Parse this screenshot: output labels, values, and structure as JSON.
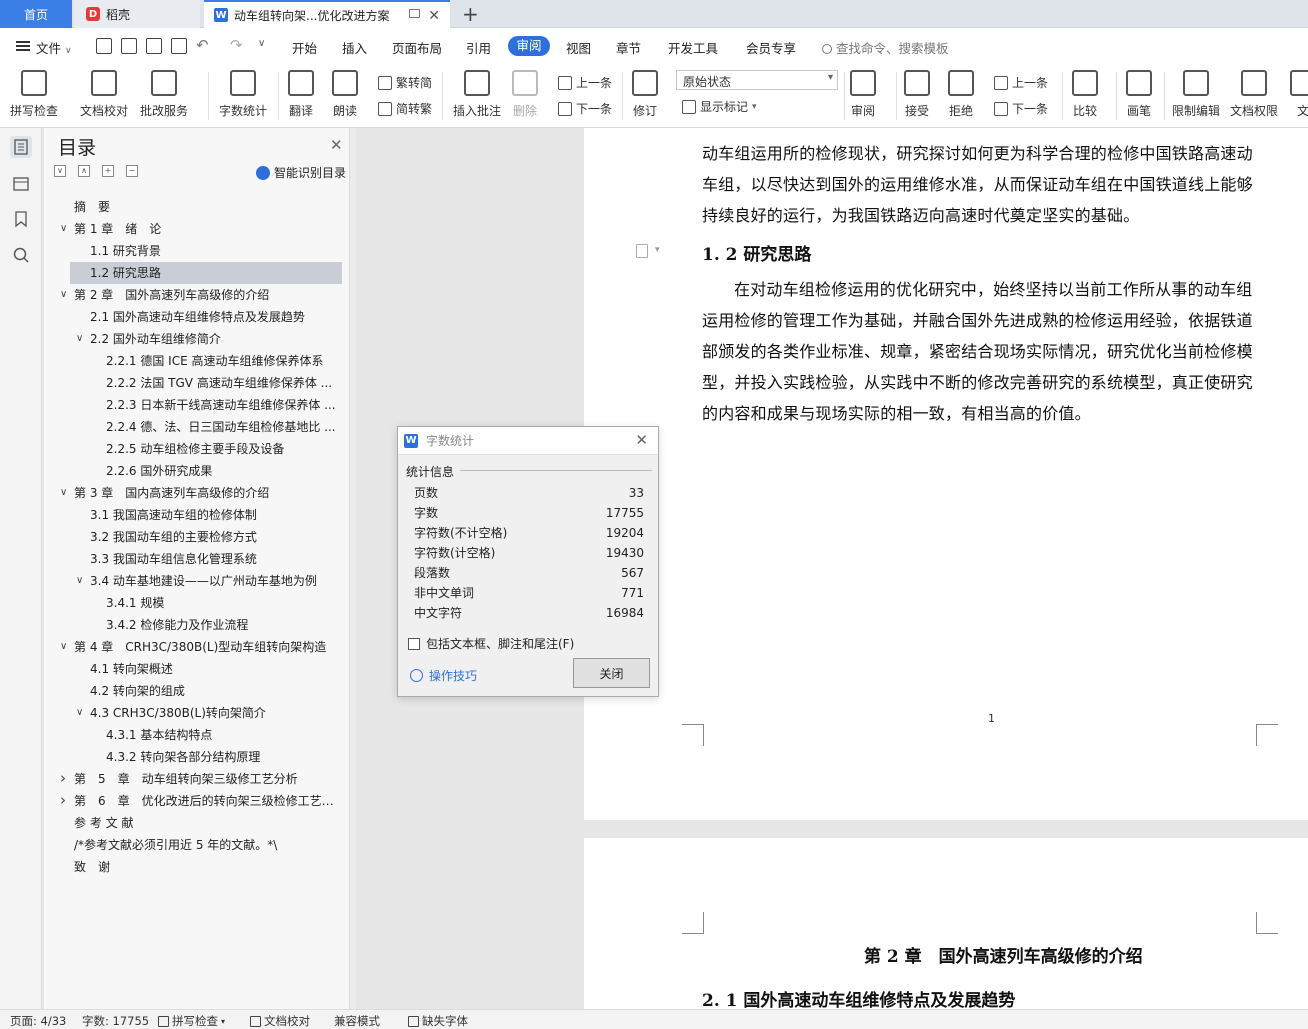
{
  "tabs": {
    "home": "首页",
    "daoke": "稻壳",
    "doc": "动车组转向架...优化改进方案"
  },
  "menu": {
    "file": "文件",
    "items": [
      "开始",
      "插入",
      "页面布局",
      "引用",
      "审阅",
      "视图",
      "章节",
      "开发工具",
      "会员专享"
    ],
    "active": "审阅",
    "search_placeholder": "查找命令、搜索模板"
  },
  "ribbon": {
    "spellcheck": "拼写检查",
    "doc_proof": "文档校对",
    "batch_service": "批改服务",
    "word_count": "字数统计",
    "translate": "翻译",
    "read_aloud": "朗读",
    "trad_to_simp": "繁转简",
    "simp_to_trad": "简转繁",
    "insert_comment": "插入批注",
    "delete": "删除",
    "prev": "上一条",
    "next": "下一条",
    "revise": "修订",
    "status_value": "原始状态",
    "show_marks": "显示标记",
    "review": "审阅",
    "accept": "接受",
    "reject": "拒绝",
    "prev2": "上一条",
    "next2": "下一条",
    "compare": "比较",
    "pen": "画笔",
    "restrict_edit": "限制编辑",
    "doc_rights": "文档权限",
    "doc_cut": "文"
  },
  "toc": {
    "title": "目录",
    "smart": "智能识别目录",
    "items": [
      {
        "text": "摘　要",
        "level": 0,
        "caret": ""
      },
      {
        "text": "第 1 章　绪　论",
        "level": 0,
        "caret": "v"
      },
      {
        "text": "1.1 研究背景",
        "level": 1,
        "caret": ""
      },
      {
        "text": "1.2 研究思路",
        "level": 1,
        "caret": "",
        "selected": true
      },
      {
        "text": "第 2 章　国外高速列车高级修的介绍",
        "level": 0,
        "caret": "v"
      },
      {
        "text": "2.1 国外高速动车组维修特点及发展趋势",
        "level": 1,
        "caret": ""
      },
      {
        "text": "2.2 国外动车组维修简介",
        "level": 1,
        "caret": "v"
      },
      {
        "text": "2.2.1 德国 ICE 高速动车组维修保养体系",
        "level": 2,
        "caret": ""
      },
      {
        "text": "2.2.2  法国 TGV 高速动车组维修保养体 ...",
        "level": 2,
        "caret": ""
      },
      {
        "text": "2.2.3 日本新干线高速动车组维修保养体 ...",
        "level": 2,
        "caret": ""
      },
      {
        "text": "2.2.4 德、法、日三国动车组检修基地比 ...",
        "level": 2,
        "caret": ""
      },
      {
        "text": "2.2.5 动车组检修主要手段及设备",
        "level": 2,
        "caret": ""
      },
      {
        "text": "2.2.6 国外研究成果",
        "level": 2,
        "caret": ""
      },
      {
        "text": "第 3 章　国内高速列车高级修的介绍",
        "level": 0,
        "caret": "v"
      },
      {
        "text": "3.1 我国高速动车组的检修体制",
        "level": 1,
        "caret": ""
      },
      {
        "text": "3.2 我国动车组的主要检修方式",
        "level": 1,
        "caret": ""
      },
      {
        "text": "3.3 我国动车组信息化管理系统",
        "level": 1,
        "caret": ""
      },
      {
        "text": "3.4 动车基地建设——以广州动车基地为例",
        "level": 1,
        "caret": "v"
      },
      {
        "text": "3.4.1 规模",
        "level": 2,
        "caret": ""
      },
      {
        "text": "3.4.2 检修能力及作业流程",
        "level": 2,
        "caret": ""
      },
      {
        "text": "第 4 章　CRH3C/380B(L)型动车组转向架构造",
        "level": 0,
        "caret": "v"
      },
      {
        "text": "4.1 转向架概述",
        "level": 1,
        "caret": ""
      },
      {
        "text": "4.2 转向架的组成",
        "level": 1,
        "caret": ""
      },
      {
        "text": "4.3 CRH3C/380B(L)转向架简介",
        "level": 1,
        "caret": "v"
      },
      {
        "text": "4.3.1 基本结构特点",
        "level": 2,
        "caret": ""
      },
      {
        "text": "4.3.2 转向架各部分结构原理",
        "level": 2,
        "caret": ""
      },
      {
        "text": "第　5　章　动车组转向架三级修工艺分析",
        "level": 0,
        "caret": ">"
      },
      {
        "text": "第　6　章　优化改进后的转向架三级检修工艺方 ...",
        "level": 0,
        "caret": ">"
      },
      {
        "text": "参 考 文 献",
        "level": 0,
        "caret": ""
      },
      {
        "text": "/*参考文献必须引用近 5 年的文献。*\\",
        "level": 0,
        "caret": ""
      },
      {
        "text": "致　谢",
        "level": 0,
        "caret": ""
      }
    ]
  },
  "document": {
    "para1": "动车组运用所的检修现状，研究探讨如何更为科学合理的检修中国铁路高速动车组，以尽快达到国外的运用维修水准，从而保证动车组在中国铁道线上能够持续良好的运行，为我国铁路迈向高速时代奠定坚实的基础。",
    "heading": "1. 2 研究思路",
    "para2": "在对动车组检修运用的优化研究中，始终坚持以当前工作所从事的动车组运用检修的管理工作为基础，并融合国外先进成熟的检修运用经验，依据铁道部颁发的各类作业标准、规章，紧密结合现场实际情况，研究优化当前检修模型，并投入实践检验，从实践中不断的修改完善研究的系统模型，真正使研究的内容和成果与现场实际的相一致，有相当高的价值。",
    "page_number": "1",
    "chapter2": "第 2 章　国外高速列车高级修的介绍",
    "section21": "2. 1 国外高速动车组维修特点及发展趋势"
  },
  "dialog": {
    "title": "字数统计",
    "group": "统计信息",
    "rows": [
      {
        "label": "页数",
        "value": "33"
      },
      {
        "label": "字数",
        "value": "17755"
      },
      {
        "label": "字符数(不计空格)",
        "value": "19204"
      },
      {
        "label": "字符数(计空格)",
        "value": "19430"
      },
      {
        "label": "段落数",
        "value": "567"
      },
      {
        "label": "非中文单词",
        "value": "771"
      },
      {
        "label": "中文字符",
        "value": "16984"
      }
    ],
    "checkbox": "包括文本框、脚注和尾注(F)",
    "tips": "操作技巧",
    "close": "关闭"
  },
  "status": {
    "page": "页面: 4/33",
    "words": "字数: 17755",
    "spell": "拼写检查",
    "proof": "文档校对",
    "compat": "兼容模式",
    "missing_font": "缺失字体"
  },
  "colors": {
    "accent": "#2f6fdc",
    "home_tab": "#3b7fe6",
    "daoke_logo": "#e8393a"
  }
}
